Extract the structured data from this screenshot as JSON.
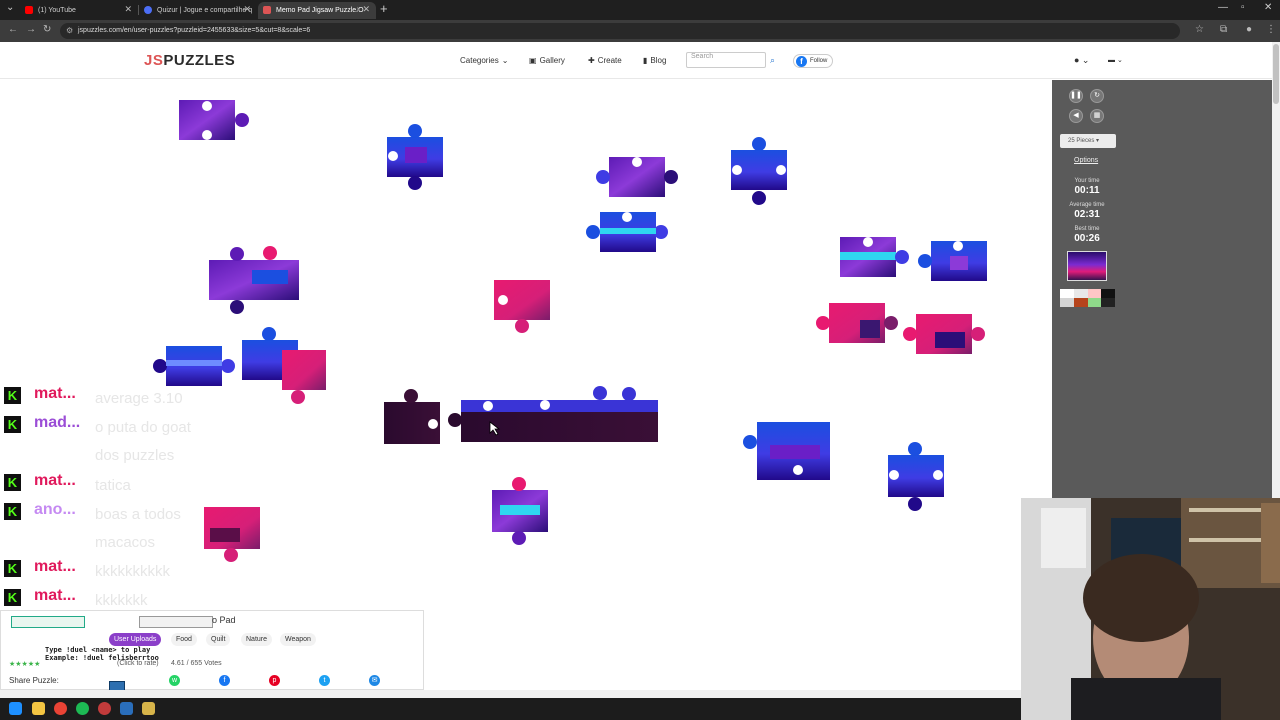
{
  "browser": {
    "tabs": [
      {
        "label": "(1) YouTube",
        "favicon_color": "#ff0000"
      },
      {
        "label": "Quizur | Jogue e compartilhe q",
        "favicon_color": "#4c6ef5"
      },
      {
        "label": "Memo Pad Jigsaw Puzzle O",
        "favicon_color": "#d55"
      }
    ],
    "url": "jspuzzles.com/en/user-puzzles?puzzleid=2455633&size=5&cut=8&scale=6"
  },
  "site": {
    "logo_js": "JS",
    "logo_rest": "PUZZLES",
    "menu": {
      "categories": "Categories",
      "gallery": "Gallery",
      "create": "Create",
      "blog": "Blog"
    },
    "search_placeholder": "Search",
    "follow_label": "Follow"
  },
  "sidebar": {
    "pieces_label": "25 Pieces",
    "options_label": "Options",
    "your_time_label": "Your time",
    "your_time": "00:11",
    "average_time_label": "Average time",
    "average_time": "02:31",
    "best_time_label": "Best time",
    "best_time": "00:26",
    "swatches": [
      "#ffffff",
      "#e8e8e8",
      "#ffc6c6",
      "#111111",
      "#d4d4d4",
      "#b5441c",
      "#8fd98a",
      "#222222"
    ]
  },
  "chat": [
    {
      "user": "mat...",
      "message": "average 3.10",
      "color": "#e0195c"
    },
    {
      "user": "mad...",
      "message": "o puta do goat",
      "color": "#9b4dd6"
    },
    {
      "user": "",
      "message": "dos puzzles",
      "color": "#e0195c"
    },
    {
      "user": "mat...",
      "message": "tatica",
      "color": "#e0195c"
    },
    {
      "user": "ano...",
      "message": "boas a todos",
      "color": "#c58af2"
    },
    {
      "user": "",
      "message": "macacos",
      "color": "#e0195c"
    },
    {
      "user": "mat...",
      "message": "kkkkkkkkkk",
      "color": "#e0195c"
    },
    {
      "user": "mat...",
      "message": "kkkkkkk",
      "color": "#e0195c"
    }
  ],
  "info": {
    "title_suffix": "o Pad",
    "categories": [
      "User Uploads",
      "Food",
      "Quilt",
      "Nature",
      "Weapon"
    ],
    "overlay_line1": "Type !duel <name> to play",
    "overlay_line2": "Example: !duel felisberrtoo",
    "rating_hint": "(Click to rate)",
    "rating": "4.61 / 655 Votes",
    "share_label": "Share Puzzle:"
  }
}
